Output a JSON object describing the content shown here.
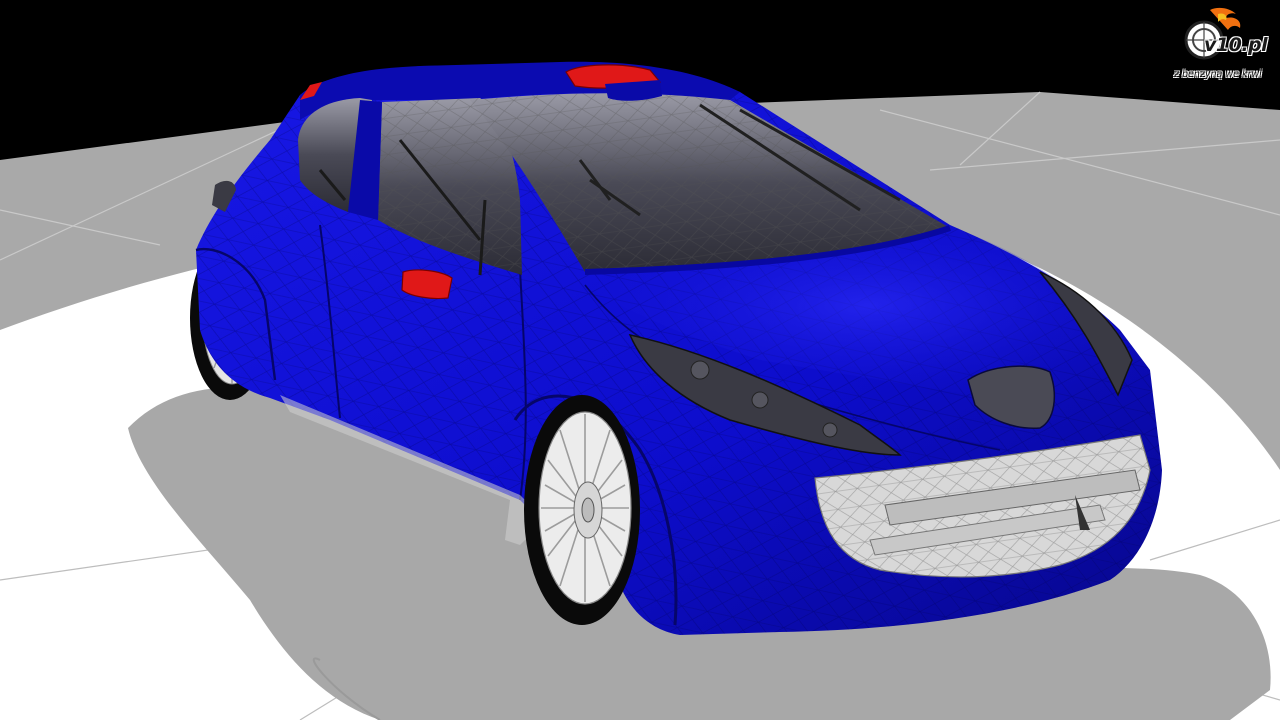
{
  "scene": {
    "subject": "blue rally hatchback wireframe render",
    "colors": {
      "background": "#000000",
      "floor_light": "#ffffff",
      "floor_dark": "#a9a9a9",
      "body_blue": "#1010d8",
      "body_blue_dark": "#06067a",
      "accent_red": "#e01818",
      "wheel": "#e6e6e6",
      "glass": "#3a3a46"
    }
  },
  "watermark": {
    "brand": "v10.pl",
    "tagline": "z benzyną we krwi",
    "icon": "tire-flame-icon"
  }
}
